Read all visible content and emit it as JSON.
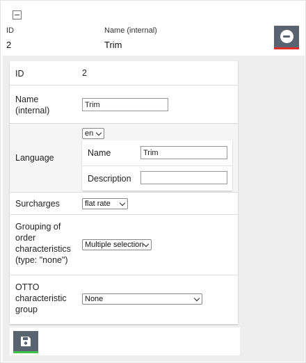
{
  "header": {
    "id_label": "ID",
    "name_label": "Name (internal)",
    "id_value": "2",
    "name_value": "Trim"
  },
  "form": {
    "id": {
      "label": "ID",
      "value": "2"
    },
    "name": {
      "label": "Name\n(internal)",
      "value": "Trim"
    },
    "language": {
      "label": "Language",
      "selected": "en",
      "name_label": "Name",
      "name_value": "Trim",
      "description_label": "Description",
      "description_value": ""
    },
    "surcharges": {
      "label": "Surcharges",
      "selected": "flat rate"
    },
    "grouping": {
      "label": "Grouping of\norder\ncharacteristics\n(type: \"none\")",
      "selected": "Multiple selection"
    },
    "otto": {
      "label": "OTTO\ncharacteristic\ngroup",
      "selected": "None"
    }
  },
  "icons": {
    "collapse": "minus-square-icon",
    "remove": "minus-circle-icon",
    "save": "floppy-disk-icon"
  },
  "colors": {
    "button_bg": "#5a6470",
    "remove_accent": "#e02b2b",
    "save_accent": "#3fc24a",
    "panel_bg": "#eeeeee"
  }
}
